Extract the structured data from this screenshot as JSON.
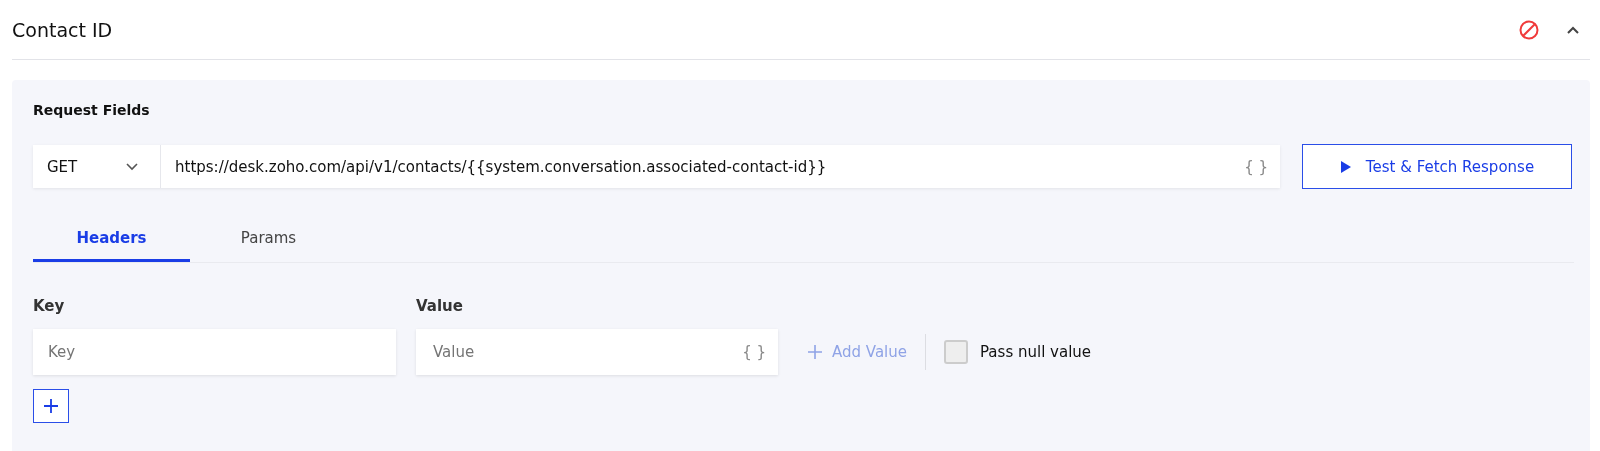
{
  "section": {
    "title": "Contact ID",
    "expanded": true
  },
  "request": {
    "heading": "Request Fields",
    "method": "GET",
    "url": "https://desk.zoho.com/api/v1/contacts/{{system.conversation.associated-contact-id}}",
    "url_variable_button": "{ }",
    "test_button": "Test & Fetch Response"
  },
  "tabs": [
    {
      "label": "Headers",
      "selected": true
    },
    {
      "label": "Params",
      "selected": false
    }
  ],
  "headers": {
    "key_label": "Key",
    "value_label": "Value",
    "key_field": {
      "placeholder": "Key"
    },
    "value_field": {
      "placeholder": "Value",
      "variable_button": "{ }"
    },
    "add_value": {
      "label": "Add Value",
      "disabled": true
    },
    "pass_null": {
      "label": "Pass null value",
      "checked": false
    }
  }
}
